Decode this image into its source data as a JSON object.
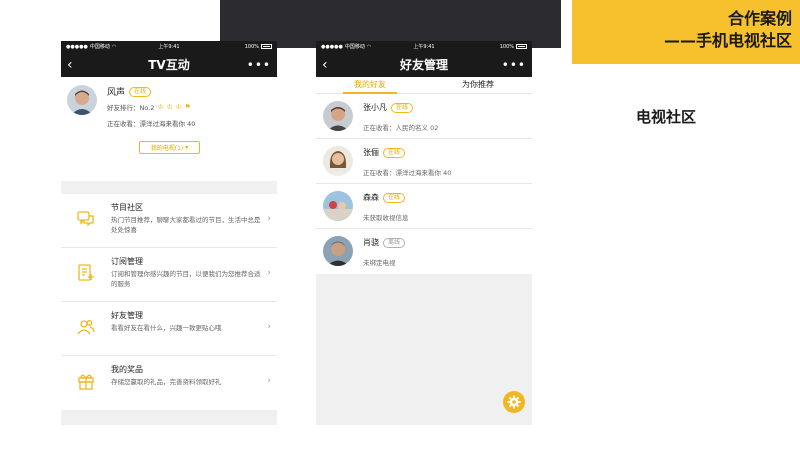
{
  "slide": {
    "title_line1": "合作案例",
    "title_line2": "——手机电视社区",
    "section_label": "电视社区"
  },
  "statusbar": {
    "carrier": "中国移动",
    "time": "上午9:41",
    "battery": "100%"
  },
  "phone1": {
    "nav_title": "TV互动",
    "profile": {
      "name": "风声",
      "online_tag": "在线",
      "rank_label": "好友排行：No.2",
      "watching": "正在收看：漂洋过海来看你 40",
      "my_tv_button": "我的电视(1)"
    },
    "menu": [
      {
        "title": "节目社区",
        "desc": "热门节目推荐，聊聊大家都看过的节目，生活中总是处处惊喜",
        "icon": "chat-bubbles-icon"
      },
      {
        "title": "订阅管理",
        "desc": "订阅和管理你感兴趣的节目，以便我们为您推荐合适的服务",
        "icon": "subscribe-list-icon"
      },
      {
        "title": "好友管理",
        "desc": "看看好友在看什么，兴趣一致更贴心哦",
        "icon": "friends-icon"
      },
      {
        "title": "我的奖品",
        "desc": "存储您赢取的礼品，完善资料领取好礼",
        "icon": "gift-icon"
      }
    ]
  },
  "phone2": {
    "nav_title": "好友管理",
    "tabs": [
      {
        "label": "我的好友"
      },
      {
        "label": "为你推荐"
      }
    ],
    "friends": [
      {
        "name": "张小凡",
        "tag": "在线",
        "status": "正在收看：人民的名义 02"
      },
      {
        "name": "张俪",
        "tag": "在线",
        "status": "正在收看：漂洋过海来看你 40"
      },
      {
        "name": "森森",
        "tag": "在线",
        "status": "未获取收视信息"
      },
      {
        "name": "肖骁",
        "tag": "离线",
        "status": "未绑定电视"
      }
    ]
  },
  "colors": {
    "accent": "#f2b71d",
    "dark_bar": "#1a1a1a",
    "title_block": "#f7c12e"
  }
}
